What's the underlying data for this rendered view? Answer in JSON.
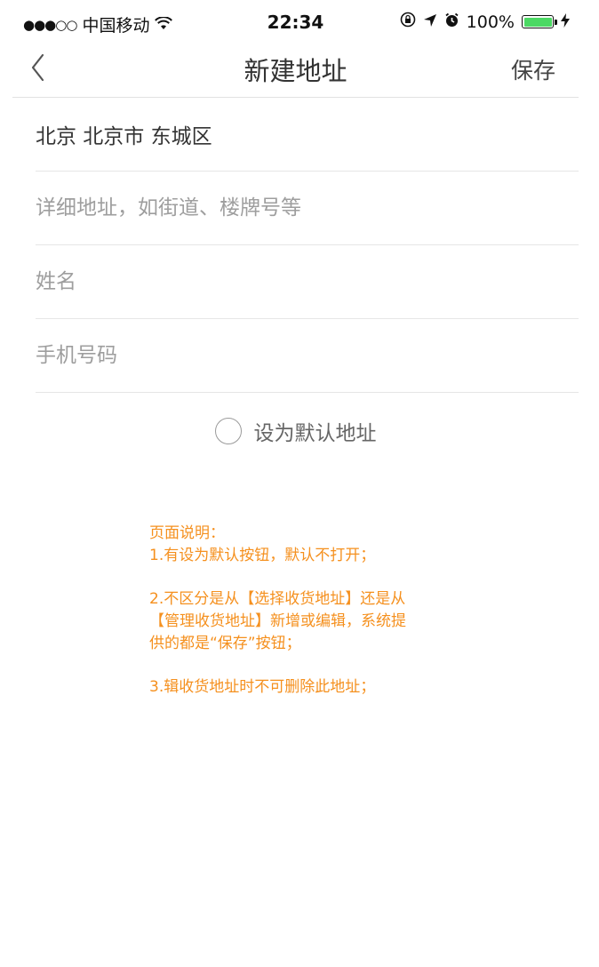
{
  "status_bar": {
    "signal": "●●●○○",
    "carrier": "中国移动",
    "wifi_icon": "wifi-icon",
    "time": "22:34",
    "battery_percent": "100%",
    "battery_level": 1.0,
    "battery_color": "#4cd964"
  },
  "nav": {
    "back_icon": "chevron-left-icon",
    "title": "新建地址",
    "save_label": "保存"
  },
  "form": {
    "region_value": "北京 北京市 东城区",
    "detail_placeholder": "详细地址，如街道、楼牌号等",
    "name_placeholder": "姓名",
    "phone_placeholder": "手机号码"
  },
  "default_toggle": {
    "label": "设为默认地址",
    "checked": false
  },
  "notes": {
    "title": "页面说明：",
    "line1": "1.有设为默认按钮，默认不打开；",
    "line2": "2.不区分是从【选择收货地址】还是从",
    "line3": "【管理收货地址】新增或编辑，系统提",
    "line4": "供的都是“保存”按钮；",
    "line5": "3.辑收货地址时不可删除此地址；",
    "color": "#f5901e"
  }
}
